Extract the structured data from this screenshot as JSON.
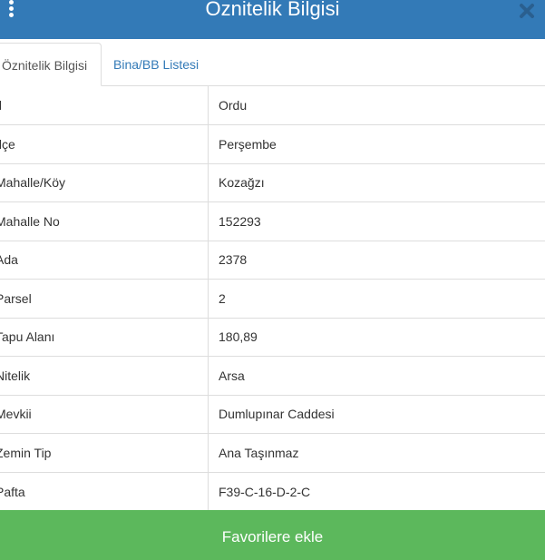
{
  "header": {
    "title": "Öznitelik Bilgisi"
  },
  "tabs": [
    {
      "label": "Öznitelik Bilgisi",
      "active": true
    },
    {
      "label": "Bina/BB Listesi",
      "active": false
    }
  ],
  "attributes": [
    {
      "key": "İl",
      "value": "Ordu"
    },
    {
      "key": "İlçe",
      "value": "Perşembe"
    },
    {
      "key": "Mahalle/Köy",
      "value": "Kozağzı"
    },
    {
      "key": "Mahalle No",
      "value": "152293"
    },
    {
      "key": "Ada",
      "value": "2378"
    },
    {
      "key": "Parsel",
      "value": "2"
    },
    {
      "key": "Tapu Alanı",
      "value": "180,89"
    },
    {
      "key": "Nitelik",
      "value": "Arsa"
    },
    {
      "key": "Mevkii",
      "value": "Dumlupınar Caddesi"
    },
    {
      "key": "Zemin Tip",
      "value": "Ana Taşınmaz"
    },
    {
      "key": "Pafta",
      "value": "F39-C-16-D-2-C"
    }
  ],
  "footer": {
    "favorite_label": "Favorilere ekle"
  },
  "colors": {
    "header": "#337ab7",
    "favorite_button": "#5cb85c",
    "tab_link": "#337ab7"
  }
}
